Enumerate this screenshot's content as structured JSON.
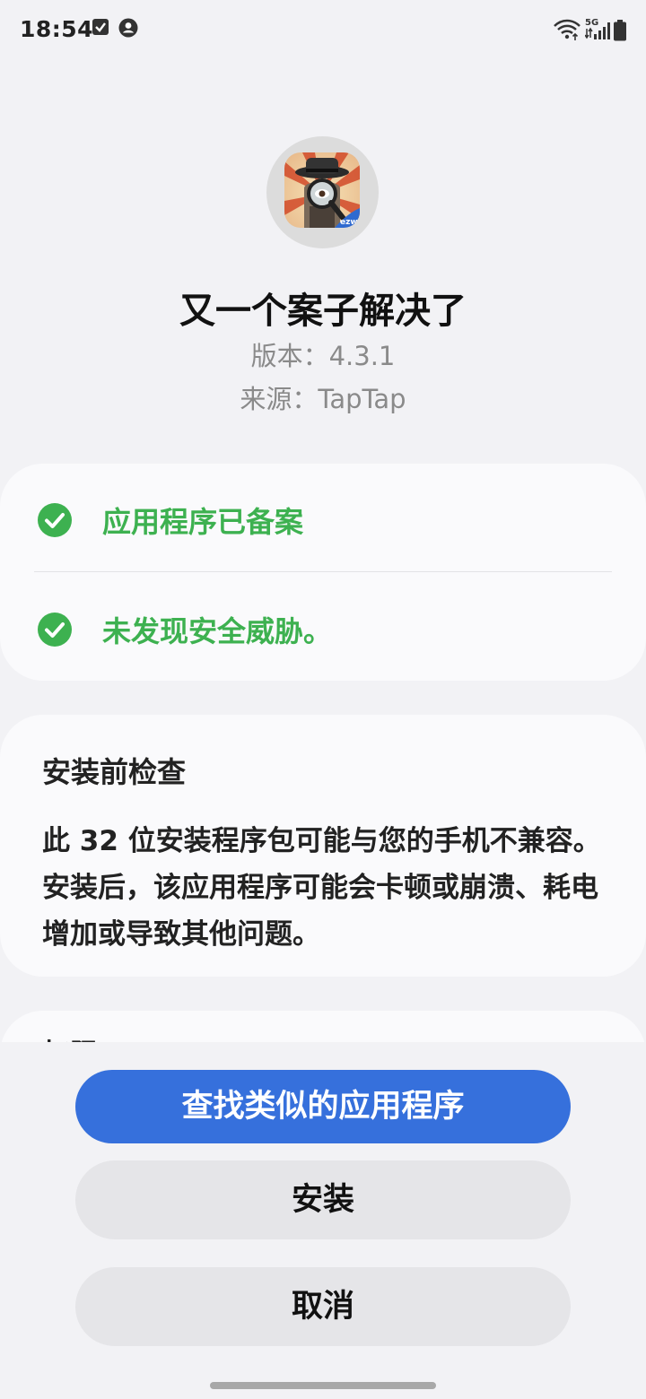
{
  "status_bar": {
    "time": "18:54",
    "network_type": "5G",
    "icons": [
      "check-box-icon",
      "account-icon",
      "wifi-icon",
      "signal-icon",
      "battery-icon"
    ]
  },
  "app": {
    "name": "又一个案子解决了",
    "version": "版本：4.3.1",
    "source": "来源：TapTap",
    "icon_badge": "ezw"
  },
  "security": {
    "items": [
      {
        "label": "应用程序已备案",
        "icon": "check-circle-icon"
      },
      {
        "label": "未发现安全威胁。",
        "icon": "check-circle-icon"
      }
    ],
    "status_color": "#3db150"
  },
  "precheck": {
    "title": "安装前检查",
    "body": "此 32 位安装程序包可能与您的手机不兼容。安装后，该应用程序可能会卡顿或崩溃、耗电增加或导致其他问题。"
  },
  "partial_card": {
    "text": "权限"
  },
  "buttons": {
    "find_similar": "查找类似的应用程序",
    "install": "安装",
    "cancel": "取消"
  },
  "colors": {
    "primary": "#3670dc",
    "background": "#f2f2f5",
    "card": "#fafafc"
  }
}
